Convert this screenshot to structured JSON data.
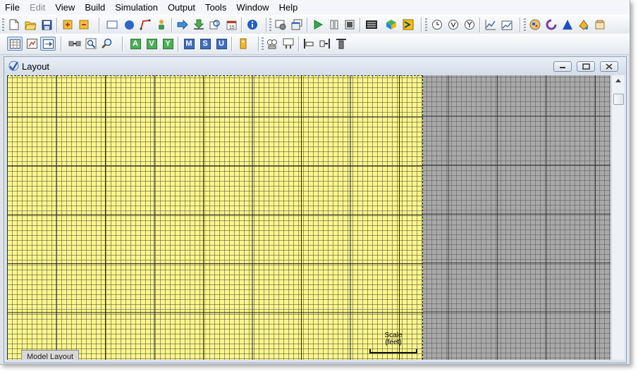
{
  "menu": {
    "items": [
      {
        "label": "File",
        "enabled": true
      },
      {
        "label": "Edit",
        "enabled": false
      },
      {
        "label": "View",
        "enabled": true
      },
      {
        "label": "Build",
        "enabled": true
      },
      {
        "label": "Simulation",
        "enabled": true
      },
      {
        "label": "Output",
        "enabled": true
      },
      {
        "label": "Tools",
        "enabled": true
      },
      {
        "label": "Window",
        "enabled": true
      },
      {
        "label": "Help",
        "enabled": true
      }
    ]
  },
  "toolbar2": {
    "letters": [
      "A",
      "V",
      "Y",
      "M",
      "S",
      "U"
    ]
  },
  "layout_window": {
    "title": "Layout",
    "tab_label": "Model Layout",
    "scale_label_1": "Scale",
    "scale_label_2": "(feet)"
  },
  "colors": {
    "layout_area": "#fbf68d",
    "outside_area": "#a9a9a9",
    "letter_green": "#4eae56",
    "letter_blue": "#3f6cc0"
  }
}
